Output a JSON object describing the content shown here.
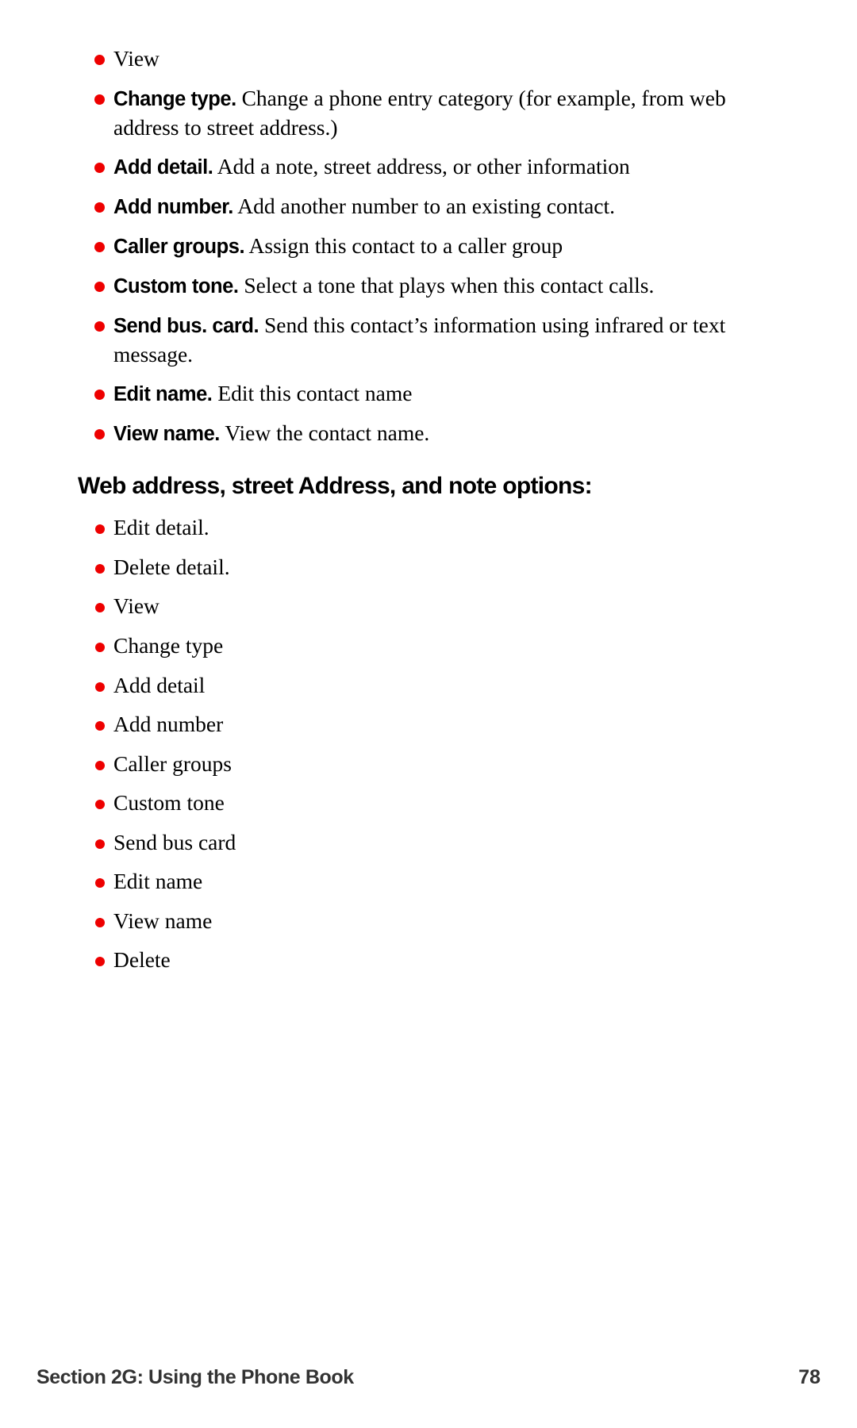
{
  "document": {
    "bullet_color": "#ee0000",
    "text_color": "#000000",
    "footer_color": "#333333"
  },
  "options_list": [
    {
      "label": "",
      "body": "View"
    },
    {
      "label": "Change type.",
      "body": "Change a phone entry category (for example, from web address to street address.)"
    },
    {
      "label": "Add detail.",
      "body": "Add a note, street address, or other information"
    },
    {
      "label": "Add number.",
      "body": "Add another number to an existing contact."
    },
    {
      "label": "Caller groups.",
      "body": "Assign this contact to a caller group"
    },
    {
      "label": "Custom tone.",
      "body": "Select a tone that plays when this contact calls."
    },
    {
      "label": "Send bus. card.",
      "body": "Send this contact’s information using infrared or text message."
    },
    {
      "label": "Edit name.",
      "body": "Edit this contact name"
    },
    {
      "label": "View name.",
      "body": "View the contact name."
    }
  ],
  "section": {
    "heading": "Web address, street Address, and note options:"
  },
  "plain_list": [
    {
      "text": "Edit detail."
    },
    {
      "text": "Delete detail."
    },
    {
      "text": "View"
    },
    {
      "text": "Change type"
    },
    {
      "text": "Add detail"
    },
    {
      "text": "Add number"
    },
    {
      "text": "Caller groups"
    },
    {
      "text": "Custom tone"
    },
    {
      "text": "Send bus card"
    },
    {
      "text": "Edit name"
    },
    {
      "text": "View name"
    },
    {
      "text": "Delete"
    }
  ],
  "footer": {
    "section_label": "Section 2G: Using the Phone Book",
    "page_number": "78"
  }
}
